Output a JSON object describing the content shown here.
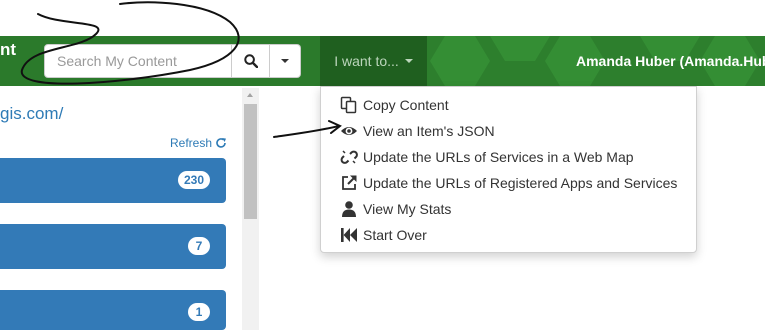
{
  "header": {
    "brand": "nt",
    "search": {
      "placeholder": "Search My Content",
      "value": ""
    },
    "i_want_to": "I want to...",
    "user": "Amanda Huber (Amanda.Huber"
  },
  "left_panel": {
    "site_link": "gis.com/",
    "small_link": "",
    "refresh_label": "Refresh",
    "cards": [
      {
        "count": "230"
      },
      {
        "count": "7"
      },
      {
        "count": "1"
      }
    ]
  },
  "menu": {
    "items": [
      {
        "label": "Copy Content",
        "icon": "copy-icon"
      },
      {
        "label": "View an Item's JSON",
        "icon": "eye-icon"
      },
      {
        "label": "Update the URLs of Services in a Web Map",
        "icon": "unlink-icon"
      },
      {
        "label": "Update the URLs of Registered Apps and Services",
        "icon": "external-link-icon"
      },
      {
        "label": "View My Stats",
        "icon": "user-icon"
      },
      {
        "label": "Start Over",
        "icon": "fast-backward-icon"
      }
    ]
  },
  "colors": {
    "nav_green": "#2d7f2d",
    "nav_dark_green": "#1f5f1f",
    "card_blue": "#337ab7",
    "link_blue": "#2e7bb6"
  }
}
